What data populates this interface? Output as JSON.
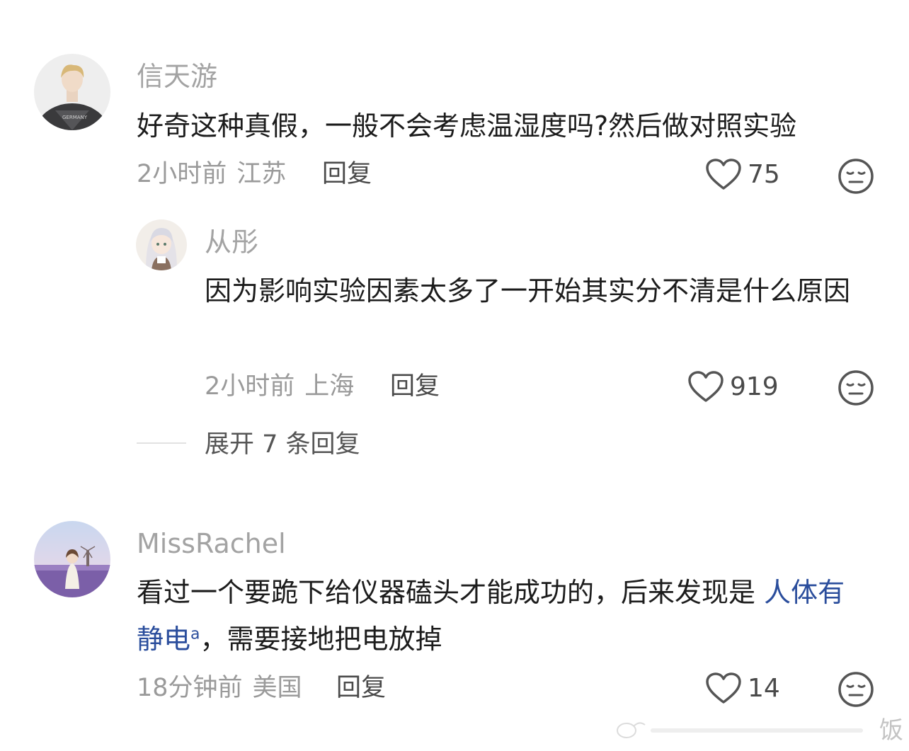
{
  "comments": [
    {
      "username": "信天游",
      "text": "好奇这种真假，一般不会考虑温湿度吗?然后做对照实验",
      "time": "2小时前",
      "location": "江苏",
      "reply_label": "回复",
      "likes": "75",
      "avatar_icon": "person-jacket-avatar",
      "replies": [
        {
          "username": "从彤",
          "text": "因为影响实验因素太多了一开始其实分不清是什么原因",
          "time": "2小时前",
          "location": "上海",
          "reply_label": "回复",
          "likes": "919",
          "avatar_icon": "anime-girl-avatar"
        }
      ],
      "expand_label": "展开 7 条回复"
    },
    {
      "username": "MissRachel",
      "text_before": "看过一个要跪下给仪器磕头才能成功的，后来发现是 ",
      "text_link": "人体有静电",
      "text_after": "，需要接地把电放掉",
      "time": "18分钟前",
      "location": "美国",
      "reply_label": "回复",
      "likes": "14",
      "avatar_icon": "lavender-field-avatar"
    }
  ],
  "watermark": {
    "text": "饭"
  },
  "colors": {
    "username": "#a3a3a3",
    "text": "#1c1c1c",
    "meta": "#9a9a9a",
    "link": "#2a4d9c",
    "icon": "#555555"
  }
}
